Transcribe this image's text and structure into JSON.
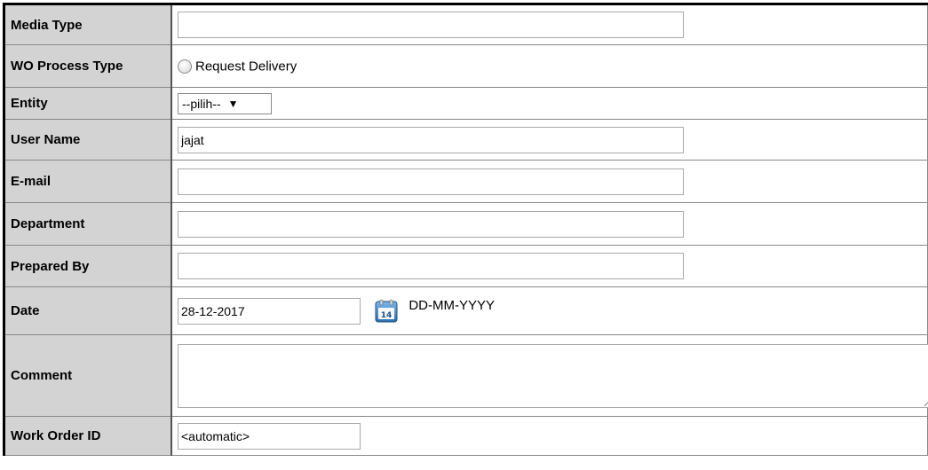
{
  "form": {
    "rows": {
      "media_type": {
        "label": "Media Type",
        "value": ""
      },
      "wo_process_type": {
        "label": "WO Process Type",
        "option": "Request Delivery"
      },
      "entity": {
        "label": "Entity",
        "selected": "--pilih--"
      },
      "user_name": {
        "label": "User Name",
        "value": "jajat"
      },
      "email": {
        "label": "E-mail",
        "value": ""
      },
      "department": {
        "label": "Department",
        "value": ""
      },
      "prepared_by": {
        "label": "Prepared By",
        "value": ""
      },
      "date": {
        "label": "Date",
        "value": "28-12-2017",
        "format_hint": "DD-MM-YYYY",
        "icon": "calendar-icon"
      },
      "comment": {
        "label": "Comment",
        "value": ""
      },
      "work_order_id": {
        "label": "Work Order ID",
        "value": "<automatic>"
      }
    }
  }
}
